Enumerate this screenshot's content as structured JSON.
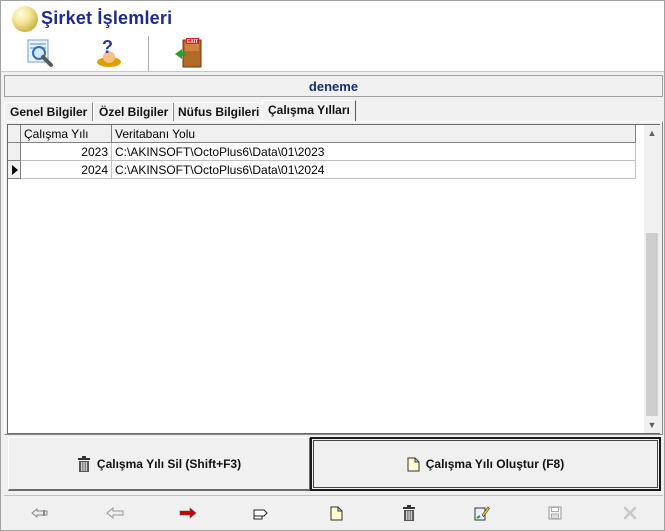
{
  "window": {
    "title": "Şirket İşlemleri"
  },
  "toolbar": {
    "buttons": [
      {
        "name": "search-icon"
      },
      {
        "name": "help-icon"
      },
      {
        "name": "exit-icon",
        "badge": "EXIT"
      }
    ]
  },
  "company": {
    "name": "deneme"
  },
  "tabs": [
    {
      "label": "Genel Bilgiler",
      "active": false
    },
    {
      "label": "Özel Bilgiler",
      "active": false
    },
    {
      "label": "Nüfus Bilgileri",
      "active": false
    },
    {
      "label": "Çalışma Yılları",
      "active": true
    }
  ],
  "grid": {
    "columns": [
      "Çalışma Yılı",
      "Veritabanı Yolu"
    ],
    "rows": [
      {
        "year": "2023",
        "path": "C:\\AKINSOFT\\OctoPlus6\\Data\\01\\2023",
        "current": false
      },
      {
        "year": "2024",
        "path": "C:\\AKINSOFT\\OctoPlus6\\Data\\01\\2024",
        "current": true
      }
    ]
  },
  "actions": {
    "delete_label": "Çalışma Yılı Sil (Shift+F3)",
    "create_label": "Çalışma Yılı Oluştur (F8)"
  },
  "nav_buttons": [
    "first-record-icon",
    "previous-icon",
    "next-icon",
    "last-record-icon",
    "new-record-icon",
    "delete-icon",
    "edit-icon",
    "save-icon",
    "cancel-icon"
  ],
  "colors": {
    "title": "#1e2b8e",
    "company": "#1a2d6b",
    "next_arrow": "#cc0000"
  }
}
